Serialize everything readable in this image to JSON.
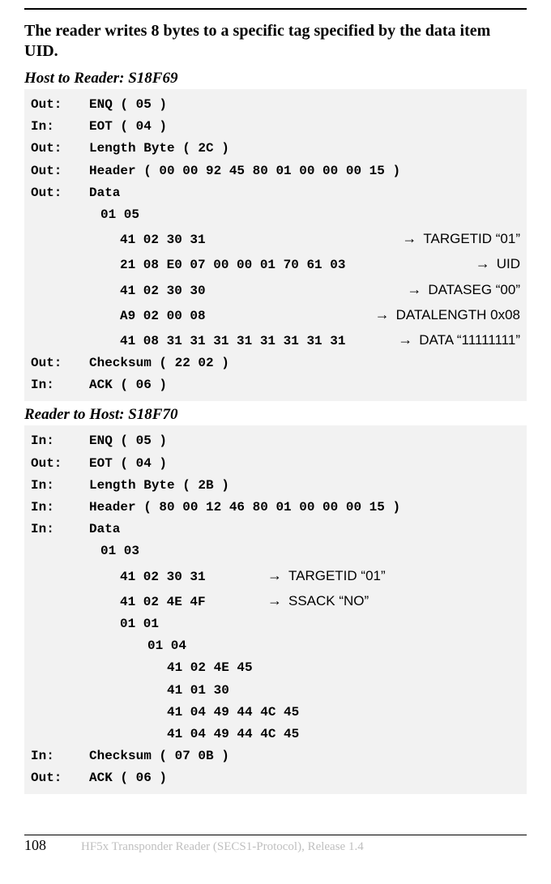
{
  "title": "The reader writes 8 bytes to a specific tag specified by the data item UID.",
  "section1": {
    "heading": "Host to Reader: S18F69",
    "rows": {
      "r0_label": "Out:",
      "r0_text": "ENQ ( 05 )",
      "r1_label": "In:",
      "r1_text": "EOT ( 04 )",
      "r2_label": "Out:",
      "r2_text": "Length Byte ( 2C )",
      "r3_label": "Out:",
      "r3_text": "Header ( 00 00 92 45 80 01 00 00 00 15 )",
      "r4_label": "Out:",
      "r4_text": "Data",
      "r5_text": "01 05",
      "a0_hex": "41 02 30 31",
      "a0_note": "TARGETID “01”",
      "a1_hex": "21 08 E0 07 00 00 01 70 61 03",
      "a1_note": "UID",
      "a2_hex": "41 02 30 30",
      "a2_note": "DATASEG “00”",
      "a3_hex": "A9 02 00 08",
      "a3_note": "DATALENGTH 0x08",
      "a4_hex": "41 08 31 31 31 31 31 31 31 31",
      "a4_note": "DATA “11111111”",
      "r6_label": "Out:",
      "r6_text": "Checksum ( 22 02 )",
      "r7_label": "In:",
      "r7_text": "ACK ( 06 )"
    }
  },
  "section2": {
    "heading": "Reader to Host: S18F70",
    "rows": {
      "r0_label": "In:",
      "r0_text": "ENQ ( 05 )",
      "r1_label": "Out:",
      "r1_text": "EOT ( 04 )",
      "r2_label": "In:",
      "r2_text": "Length Byte ( 2B )",
      "r3_label": "In:",
      "r3_text": "Header ( 80 00 12 46 80 01 00 00 00 15 )",
      "r4_label": "In:",
      "r4_text": "Data",
      "r5_text": "01 03",
      "a0_hex": "41 02 30 31",
      "a0_note": "TARGETID “01”",
      "a1_hex": "41 02 4E 4F",
      "a1_note": "SSACK “NO”",
      "r6_text": "01 01",
      "r7_text": "01 04",
      "r8_text": "41 02 4E 45",
      "r9_text": "41 01 30",
      "r10_text": "41 04 49 44 4C 45",
      "r11_text": "41 04 49 44 4C 45",
      "r12_label": "In:",
      "r12_text": "Checksum ( 07 0B )",
      "r13_label": "Out:",
      "r13_text": "ACK ( 06 )"
    }
  },
  "arrow": "→",
  "footer": {
    "page": "108",
    "text": "HF5x Transponder Reader (SECS1-Protocol), Release 1.4"
  }
}
